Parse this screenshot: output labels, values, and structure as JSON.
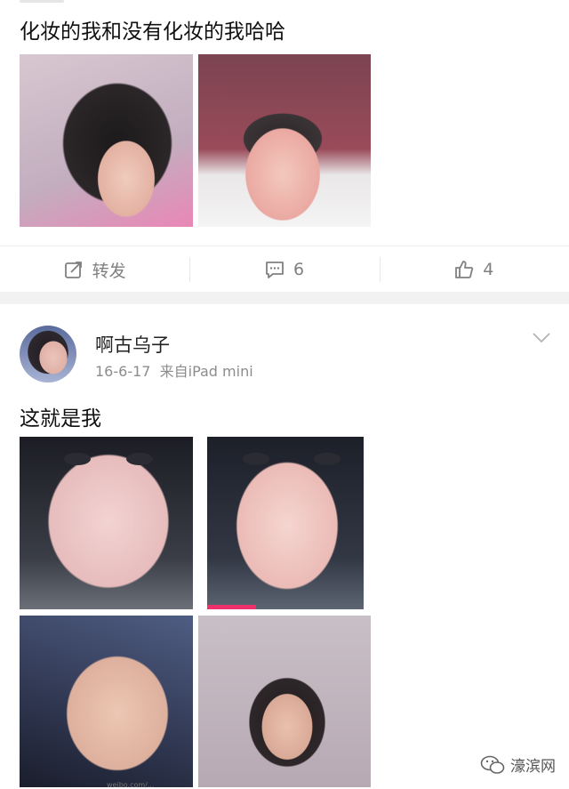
{
  "post1": {
    "text": "化妆的我和没有化妆的我哈哈",
    "actions": {
      "repost_label": "转发",
      "comment_count": "6",
      "like_count": "4"
    }
  },
  "post2": {
    "username": "啊古乌子",
    "date": "16-6-17",
    "source": "来自iPad mini",
    "text": "这就是我"
  },
  "watermark": {
    "label": "濠滨网"
  },
  "image_credit": "weibo.com/..."
}
